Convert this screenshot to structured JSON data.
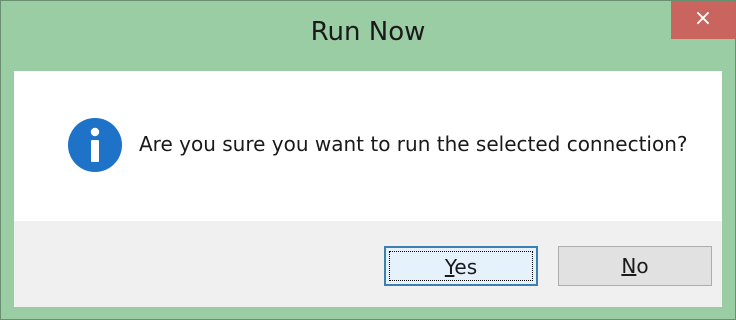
{
  "dialog": {
    "title": "Run Now",
    "close_glyph": "×",
    "message": "Are you sure you want to run the selected connection?",
    "icon": "info-icon",
    "buttons": {
      "yes": {
        "mnemonic": "Y",
        "rest": "es"
      },
      "no": {
        "mnemonic": "N",
        "rest": "o"
      }
    }
  },
  "colors": {
    "titlebar": "#9acda4",
    "close_button": "#c9645e",
    "info_icon": "#1e72c8",
    "footer": "#f0f0f0",
    "default_button_border": "#3c7fb1"
  }
}
